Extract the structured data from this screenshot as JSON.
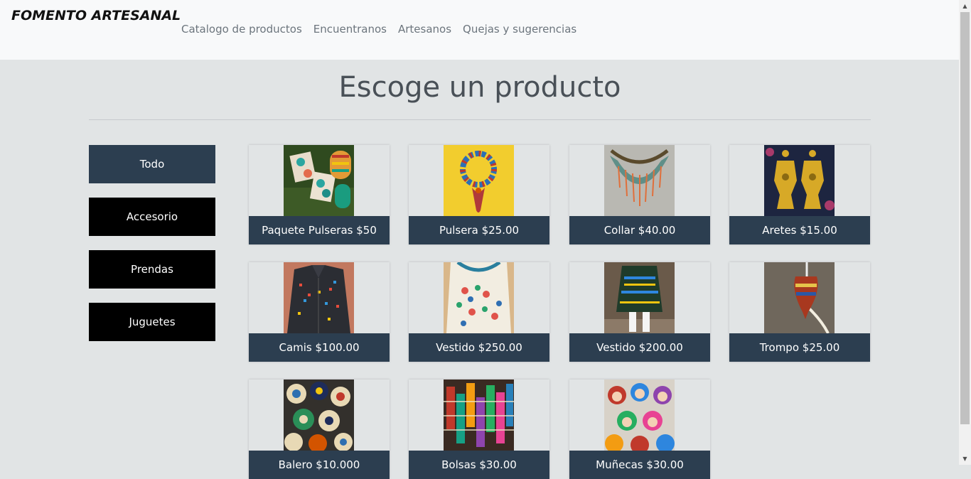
{
  "brand": "FOMENTO ARTESANAL",
  "nav": [
    "Catalogo de productos",
    "Encuentranos",
    "Artesanos",
    "Quejas y sugerencias"
  ],
  "page_title": "Escoge un producto",
  "categories": [
    {
      "label": "Todo",
      "active": true
    },
    {
      "label": "Accesorio",
      "active": false
    },
    {
      "label": "Prendas",
      "active": false
    },
    {
      "label": "Juguetes",
      "active": false
    }
  ],
  "products": [
    {
      "name": "Paquete Pulseras $50",
      "image": "bracelets-earrings-photo"
    },
    {
      "name": "Pulsera $25.00",
      "image": "bead-bracelet-photo"
    },
    {
      "name": "Collar $40.00",
      "image": "beaded-necklace-photo"
    },
    {
      "name": "Aretes $15.00",
      "image": "gold-earrings-photo"
    },
    {
      "name": "Camis $100.00",
      "image": "embroidered-shirt-photo"
    },
    {
      "name": "Vestido $250.00",
      "image": "embroidered-dress-photo"
    },
    {
      "name": "Vestido $200.00",
      "image": "child-dress-photo"
    },
    {
      "name": "Trompo $25.00",
      "image": "spinning-top-photo"
    },
    {
      "name": "Balero $10.000",
      "image": "wooden-toys-photo"
    },
    {
      "name": "Bolsas $30.00",
      "image": "woven-bags-photo"
    },
    {
      "name": "Muñecas $30.00",
      "image": "dolls-photo"
    }
  ]
}
